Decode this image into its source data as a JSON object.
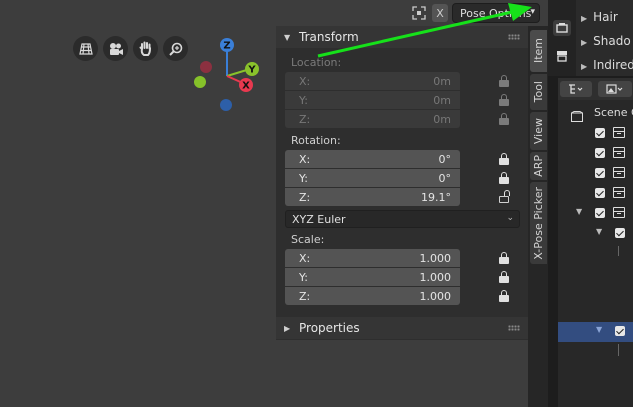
{
  "header": {
    "close_glyph": "X",
    "pose_options_label": "Pose Options"
  },
  "transform": {
    "title": "Transform",
    "location_label": "Location:",
    "location": [
      {
        "axis": "X:",
        "value": "0m"
      },
      {
        "axis": "Y:",
        "value": "0m"
      },
      {
        "axis": "Z:",
        "value": "0m"
      }
    ],
    "rotation_label": "Rotation:",
    "rotation": [
      {
        "axis": "X:",
        "value": "0°"
      },
      {
        "axis": "Y:",
        "value": "0°"
      },
      {
        "axis": "Z:",
        "value": "19.1°"
      }
    ],
    "rotation_mode": "XYZ Euler",
    "scale_label": "Scale:",
    "scale": [
      {
        "axis": "X:",
        "value": "1.000"
      },
      {
        "axis": "Y:",
        "value": "1.000"
      },
      {
        "axis": "Z:",
        "value": "1.000"
      }
    ]
  },
  "properties_section": {
    "title": "Properties"
  },
  "tabs": [
    "Item",
    "Tool",
    "View",
    "ARP",
    "X-Pose Picker"
  ],
  "gizmo": {
    "x": "X",
    "y": "Y",
    "z": "Z"
  },
  "properties_panel": {
    "rows": [
      "Hair",
      "Shado",
      "Indired"
    ]
  },
  "outliner": {
    "root_label": "Scene C"
  },
  "colors": {
    "x_axis": "#e8394f",
    "y_axis": "#89c22b",
    "z_axis": "#3a7fd8",
    "annotation_arrow": "#16e11a",
    "selected_row": "#334d80"
  }
}
